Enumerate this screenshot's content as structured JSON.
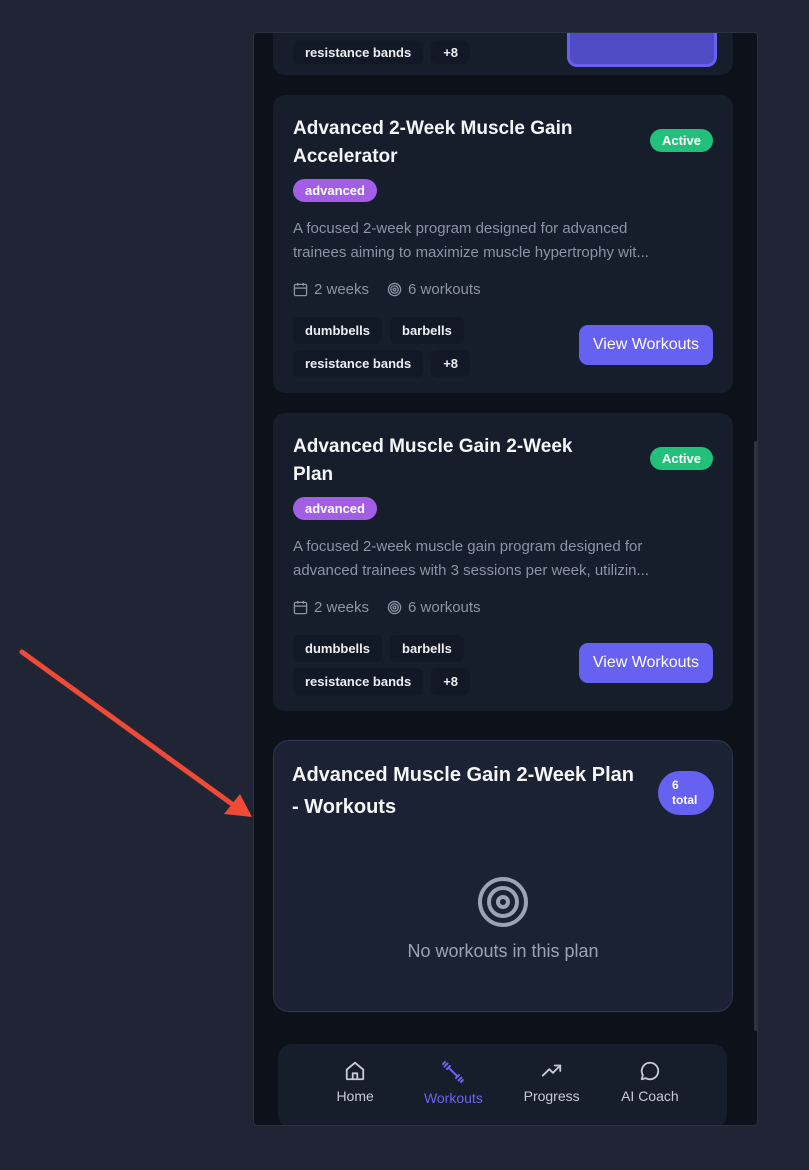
{
  "top_card": {
    "tags": [
      "resistance bands",
      "+8"
    ]
  },
  "plans": [
    {
      "title": "Advanced 2-Week Muscle Gain Accelerator",
      "status": "Active",
      "level": "advanced",
      "desc_line1": "A focused 2-week program designed for advanced",
      "desc_line2": "trainees aiming to maximize muscle hypertrophy wit...",
      "duration": "2 weeks",
      "workouts": "6 workouts",
      "tags": [
        "dumbbells",
        "barbells",
        "resistance bands",
        "+8"
      ],
      "button": "View Workouts"
    },
    {
      "title": "Advanced Muscle Gain 2-Week Plan",
      "status": "Active",
      "level": "advanced",
      "desc_line1": "A focused 2-week muscle gain program designed for",
      "desc_line2": "advanced trainees with 3 sessions per week, utilizin...",
      "duration": "2 weeks",
      "workouts": "6 workouts",
      "tags": [
        "dumbbells",
        "barbells",
        "resistance bands",
        "+8"
      ],
      "button": "View Workouts"
    }
  ],
  "workouts_panel": {
    "title": "Advanced Muscle Gain 2-Week Plan - Workouts",
    "count": "6",
    "count_label": "total",
    "empty_text": "No workouts in this plan"
  },
  "nav": [
    {
      "label": "Home",
      "icon": "home-icon",
      "active": false
    },
    {
      "label": "Workouts",
      "icon": "dumbbell-icon",
      "active": true
    },
    {
      "label": "Progress",
      "icon": "trending-up-icon",
      "active": false
    },
    {
      "label": "AI Coach",
      "icon": "chat-bubble-icon",
      "active": false
    }
  ],
  "colors": {
    "accent": "#6661f0",
    "active_badge": "#22c07a",
    "level_badge": "#a35ee6",
    "annotation_arrow": "#ef4a35"
  }
}
